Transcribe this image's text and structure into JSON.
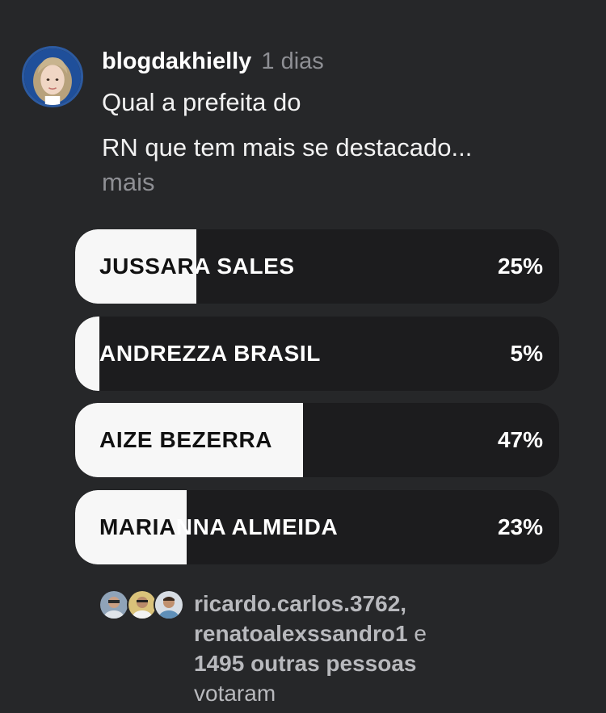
{
  "post": {
    "username": "blogdakhielly",
    "time": "1 dias",
    "question_line1": "Qual a prefeita do",
    "question_line2": "RN que tem mais se destacado...",
    "more_label": "mais"
  },
  "poll": {
    "options": [
      {
        "label": "JUSSARA SALES",
        "percent_label": "25%",
        "fill_fraction": 0.25
      },
      {
        "label": "ANDREZZA BRASIL",
        "percent_label": "5%",
        "fill_fraction": 0.05
      },
      {
        "label": "AIZE BEZERRA",
        "percent_label": "47%",
        "fill_fraction": 0.47
      },
      {
        "label": "MARIANNA ALMEIDA",
        "percent_label": "23%",
        "fill_fraction": 0.23
      }
    ]
  },
  "voters": {
    "user1": "ricardo.carlos.3762,",
    "user2": "renatoalexssandro1",
    "connector": "e",
    "others": "1495 outras pessoas",
    "suffix": "votaram"
  },
  "colors": {
    "background": "#262729",
    "option_bg": "#1c1c1e",
    "fill": "#f7f7f7",
    "muted_text": "#8e8f94"
  }
}
